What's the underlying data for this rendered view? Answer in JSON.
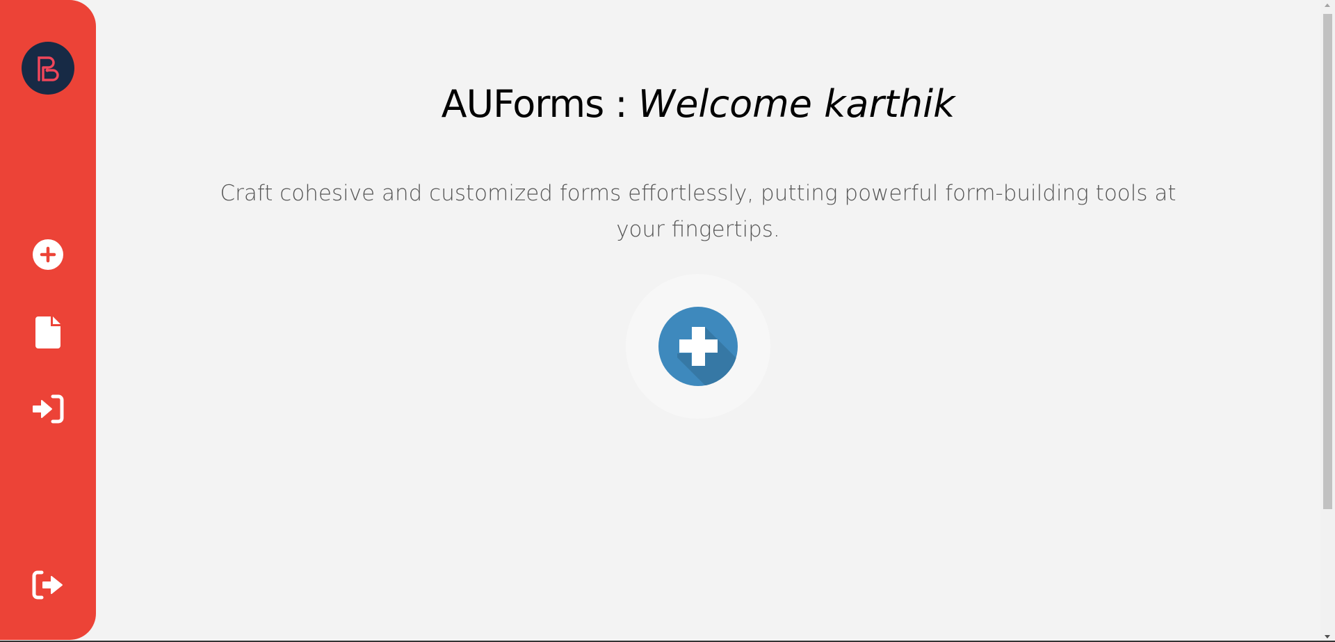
{
  "app": {
    "brand": "AUForms",
    "separator": " : ",
    "welcome": "Welcome karthik"
  },
  "subtitle": "Craft cohesive and customized forms effortlessly, putting powerful form-building tools at your fingertips.",
  "sidebar": {
    "logo_icon": "b-logo",
    "items": [
      {
        "icon": "plus-circle-icon",
        "action": "create-form"
      },
      {
        "icon": "file-icon",
        "action": "forms"
      },
      {
        "icon": "sign-in-icon",
        "action": "login"
      },
      {
        "icon": "sign-out-icon",
        "action": "logout"
      }
    ]
  },
  "colors": {
    "sidebar": "#ec4337",
    "logo_bg": "#172a45",
    "logo_fg": "#f0465a",
    "create_button": "#3e89bd",
    "background": "#f3f3f3"
  }
}
